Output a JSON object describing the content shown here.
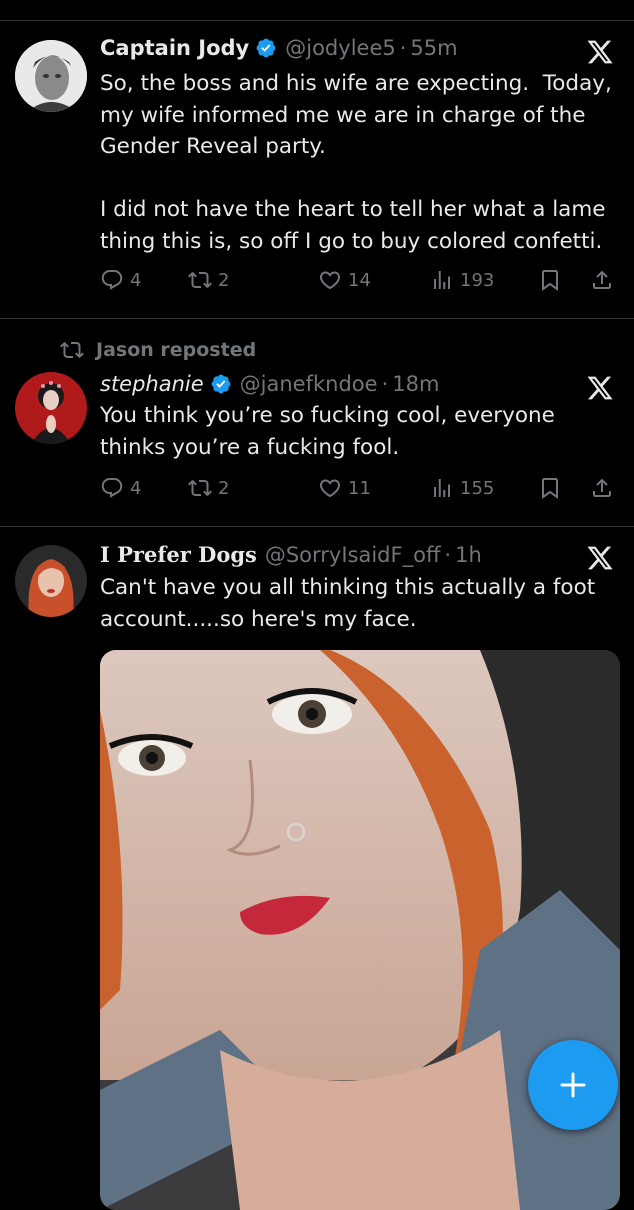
{
  "tweets": [
    {
      "name": "Captain Jody",
      "handle": "@jodylee5",
      "time": "55m",
      "text": "So, the boss and his wife are expecting.  Today, my wife informed me we are in charge of the Gender Reveal party.\n\nI did not have the heart to tell her what a lame thing this is, so off I go to buy colored confetti.",
      "replies": "4",
      "reposts": "2",
      "likes": "14",
      "views": "193"
    },
    {
      "repost_label": "Jason reposted",
      "name": "stephanie",
      "handle": "@janefkndoe",
      "time": "18m",
      "text": "You think you’re so fucking cool, everyone thinks you’re a fucking fool.",
      "replies": "4",
      "reposts": "2",
      "likes": "11",
      "views": "155"
    },
    {
      "name": "I Prefer Dogs",
      "handle": "@SorryIsaidF_off",
      "time": "1h",
      "text": "Can't have you all thinking this actually a foot account.....so here's my face."
    }
  ],
  "separator": "·",
  "icons": {
    "verified": "verified-badge-icon",
    "x_logo": "x-logo-icon",
    "reply": "reply-icon",
    "repost": "repost-icon",
    "like": "like-icon",
    "views": "views-icon",
    "bookmark": "bookmark-icon",
    "share": "share-icon",
    "compose": "plus-icon"
  },
  "colors": {
    "background": "#000000",
    "text": "#e7e9ea",
    "muted": "#71767b",
    "accent": "#1d9bf0",
    "divider": "#2f3336"
  }
}
